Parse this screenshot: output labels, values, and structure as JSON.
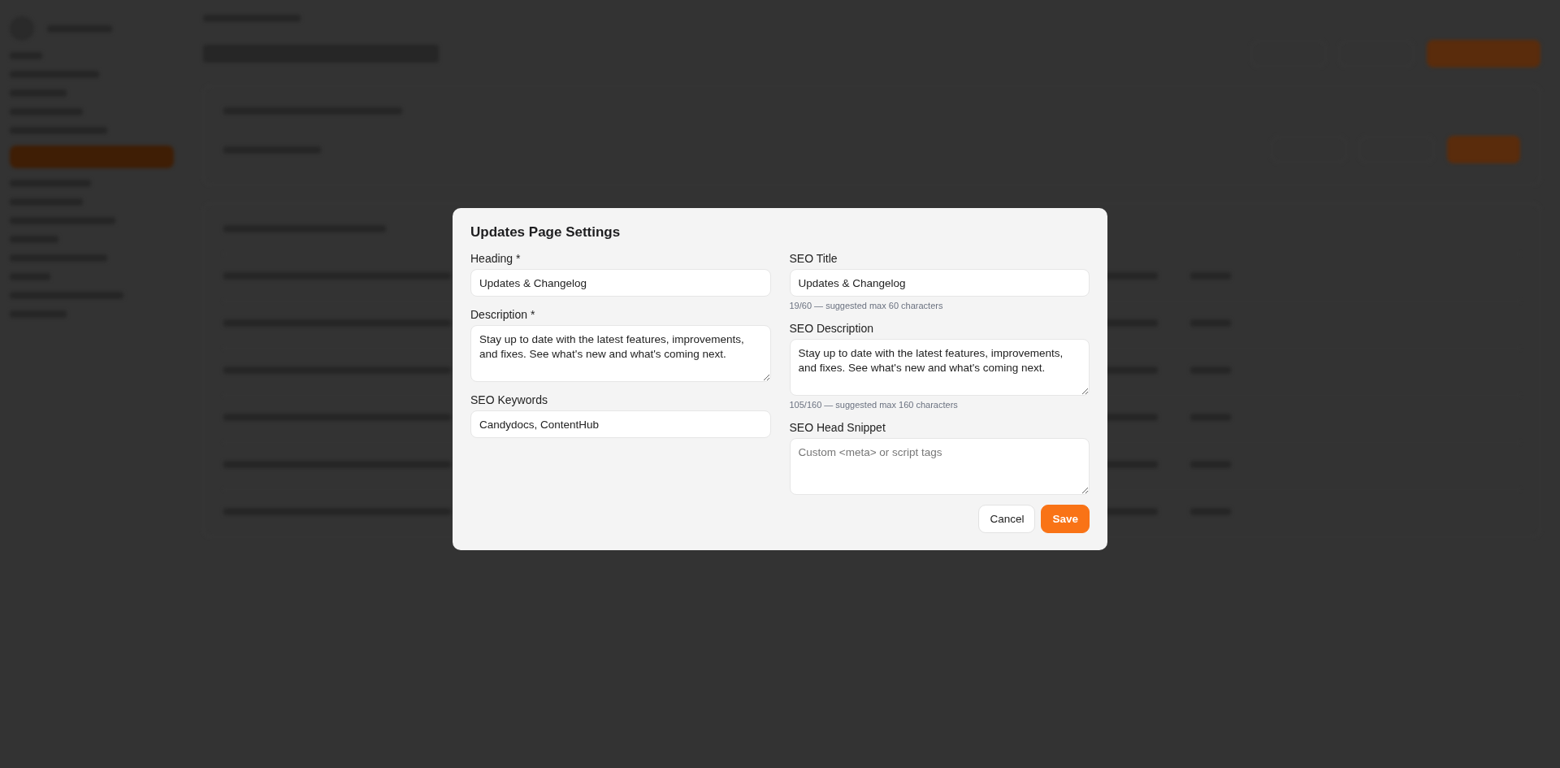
{
  "dialog": {
    "title": "Updates Page Settings",
    "columns": [
      [
        {
          "kind": "input",
          "label": "Heading *",
          "value": "Updates & Changelog"
        },
        {
          "kind": "textarea",
          "label": "Description *",
          "value": "Stay up to date with the latest features, improvements, and fixes. See what's new and what's coming next."
        },
        {
          "kind": "input",
          "label": "SEO Keywords",
          "value": "Candydocs, ContentHub"
        }
      ],
      [
        {
          "kind": "input",
          "label": "SEO Title",
          "value": "Updates & Changelog",
          "hint": "19/60 — suggested max 60 characters"
        },
        {
          "kind": "textarea",
          "label": "SEO Description",
          "value": "Stay up to date with the latest features, improvements, and fixes. See what's new and what's coming next.",
          "hint": "105/160 — suggested max 160 characters"
        },
        {
          "kind": "textarea",
          "label": "SEO Head Snippet",
          "placeholder": "Custom <meta> or script tags"
        }
      ]
    ],
    "buttons": [
      {
        "label": "Cancel",
        "kind": "secondary"
      },
      {
        "label": "Save",
        "kind": "primary"
      }
    ]
  }
}
